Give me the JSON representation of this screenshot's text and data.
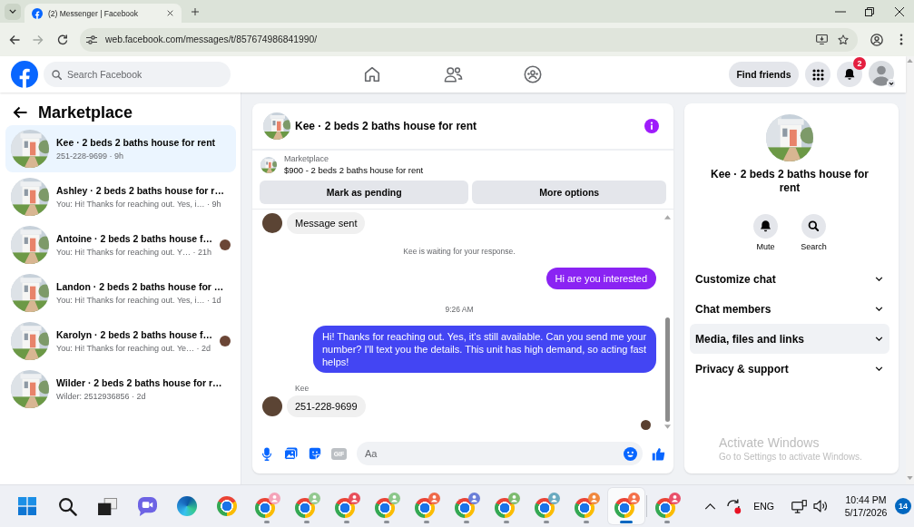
{
  "browser": {
    "tab_title": "(2) Messenger | Facebook",
    "url": "web.facebook.com/messages/t/857674986841990/"
  },
  "top_bar": {
    "search": {
      "placeholder": "Search Facebook"
    },
    "find_friends": "Find friends",
    "notification_count": "2"
  },
  "sidebar": {
    "title": "Marketplace",
    "conversations": [
      {
        "title": "Kee · 2 beds 2 baths house for rent",
        "subtitle": "251-228-9699 · 9h",
        "selected": true,
        "seen": false
      },
      {
        "title": "Ashley · 2 beds 2 baths house for r…",
        "subtitle": "You: Hi! Thanks for reaching out. Yes, i… · 9h",
        "selected": false,
        "seen": false
      },
      {
        "title": "Antoine · 2 beds 2 baths house f…",
        "subtitle": "You: Hi! Thanks for reaching out. Y… · 21h",
        "selected": false,
        "seen": true
      },
      {
        "title": "Landon · 2 beds 2 baths house for …",
        "subtitle": "You: Hi! Thanks for reaching out. Yes, i… · 1d",
        "selected": false,
        "seen": false
      },
      {
        "title": "Karolyn · 2 beds 2 baths house f…",
        "subtitle": "You: Hi! Thanks for reaching out. Ye… · 2d",
        "selected": false,
        "seen": true
      },
      {
        "title": "Wilder · 2 beds 2 baths house for r…",
        "subtitle": "Wilder: 2512936856 · 2d",
        "selected": false,
        "seen": false
      }
    ]
  },
  "chat": {
    "title": "Kee · 2 beds 2 baths house for rent",
    "listing": {
      "label": "Marketplace",
      "title": "$900 - 2 beds 2 baths house for rent"
    },
    "actions": [
      "Mark as pending",
      "More options"
    ],
    "messages": [
      {
        "kind": "incoming",
        "text": "Message sent"
      },
      {
        "kind": "notice",
        "text": "Kee is waiting for your response."
      },
      {
        "kind": "outgoing",
        "text": "Hi are you interested",
        "color": "#8a23f3"
      },
      {
        "kind": "timestamp",
        "text": "9:26 AM"
      },
      {
        "kind": "outgoing",
        "text": "Hi! Thanks for reaching out. Yes, it's still available. Can you send me your number? I'll text you the details. This unit has high demand, so acting fast helps!",
        "color": "#4345f3"
      },
      {
        "kind": "incoming",
        "sender": "Kee",
        "text": "251-228-9699"
      }
    ],
    "seen": true,
    "composer": {
      "gif": "GIF",
      "placeholder": "Aa"
    }
  },
  "details": {
    "title": "Kee · 2 beds 2 baths house for rent",
    "actions": [
      {
        "kind": "mute",
        "label": "Mute"
      },
      {
        "kind": "search",
        "label": "Search"
      }
    ],
    "sections": [
      {
        "label": "Customize chat",
        "hovered": false
      },
      {
        "label": "Chat members",
        "hovered": false
      },
      {
        "label": "Media, files and links",
        "hovered": true
      },
      {
        "label": "Privacy & support",
        "hovered": false
      }
    ]
  },
  "activation_notice": {
    "title": "Activate Windows",
    "text": "Go to Settings to activate Windows."
  },
  "taskbar": {
    "apps": [
      {
        "kind": "start"
      },
      {
        "kind": "search"
      },
      {
        "kind": "task-view"
      },
      {
        "kind": "chat"
      },
      {
        "kind": "edge"
      },
      {
        "kind": "chrome"
      },
      {
        "kind": "chrome-profile",
        "color": "#f4a3b8",
        "running": true,
        "selected": false
      },
      {
        "kind": "chrome-profile",
        "color": "#93c990",
        "running": true,
        "selected": false
      },
      {
        "kind": "chrome-profile",
        "color": "#e8505b",
        "running": true,
        "selected": false
      },
      {
        "kind": "chrome-profile",
        "color": "#8bc78a",
        "running": true,
        "selected": false
      },
      {
        "kind": "chrome-profile",
        "color": "#ef6a4a",
        "running": true,
        "selected": false
      },
      {
        "kind": "chrome-profile",
        "color": "#6b7fd8",
        "running": true,
        "selected": false
      },
      {
        "kind": "chrome-profile",
        "color": "#7dbb6f",
        "running": true,
        "selected": false
      },
      {
        "kind": "chrome-profile",
        "color": "#6aaac0",
        "running": true,
        "selected": false
      },
      {
        "kind": "chrome-profile",
        "color": "#f0883e",
        "running": true,
        "selected": false
      },
      {
        "kind": "chrome-profile",
        "color": "#f4714a",
        "running": true,
        "selected": true
      },
      {
        "kind": "separator"
      },
      {
        "kind": "chrome-profile",
        "color": "#e9506a",
        "running": true,
        "selected": false
      }
    ],
    "language": "ENG",
    "time": "10:44 PM",
    "date": "5/17/2026",
    "notification_count": "14"
  }
}
